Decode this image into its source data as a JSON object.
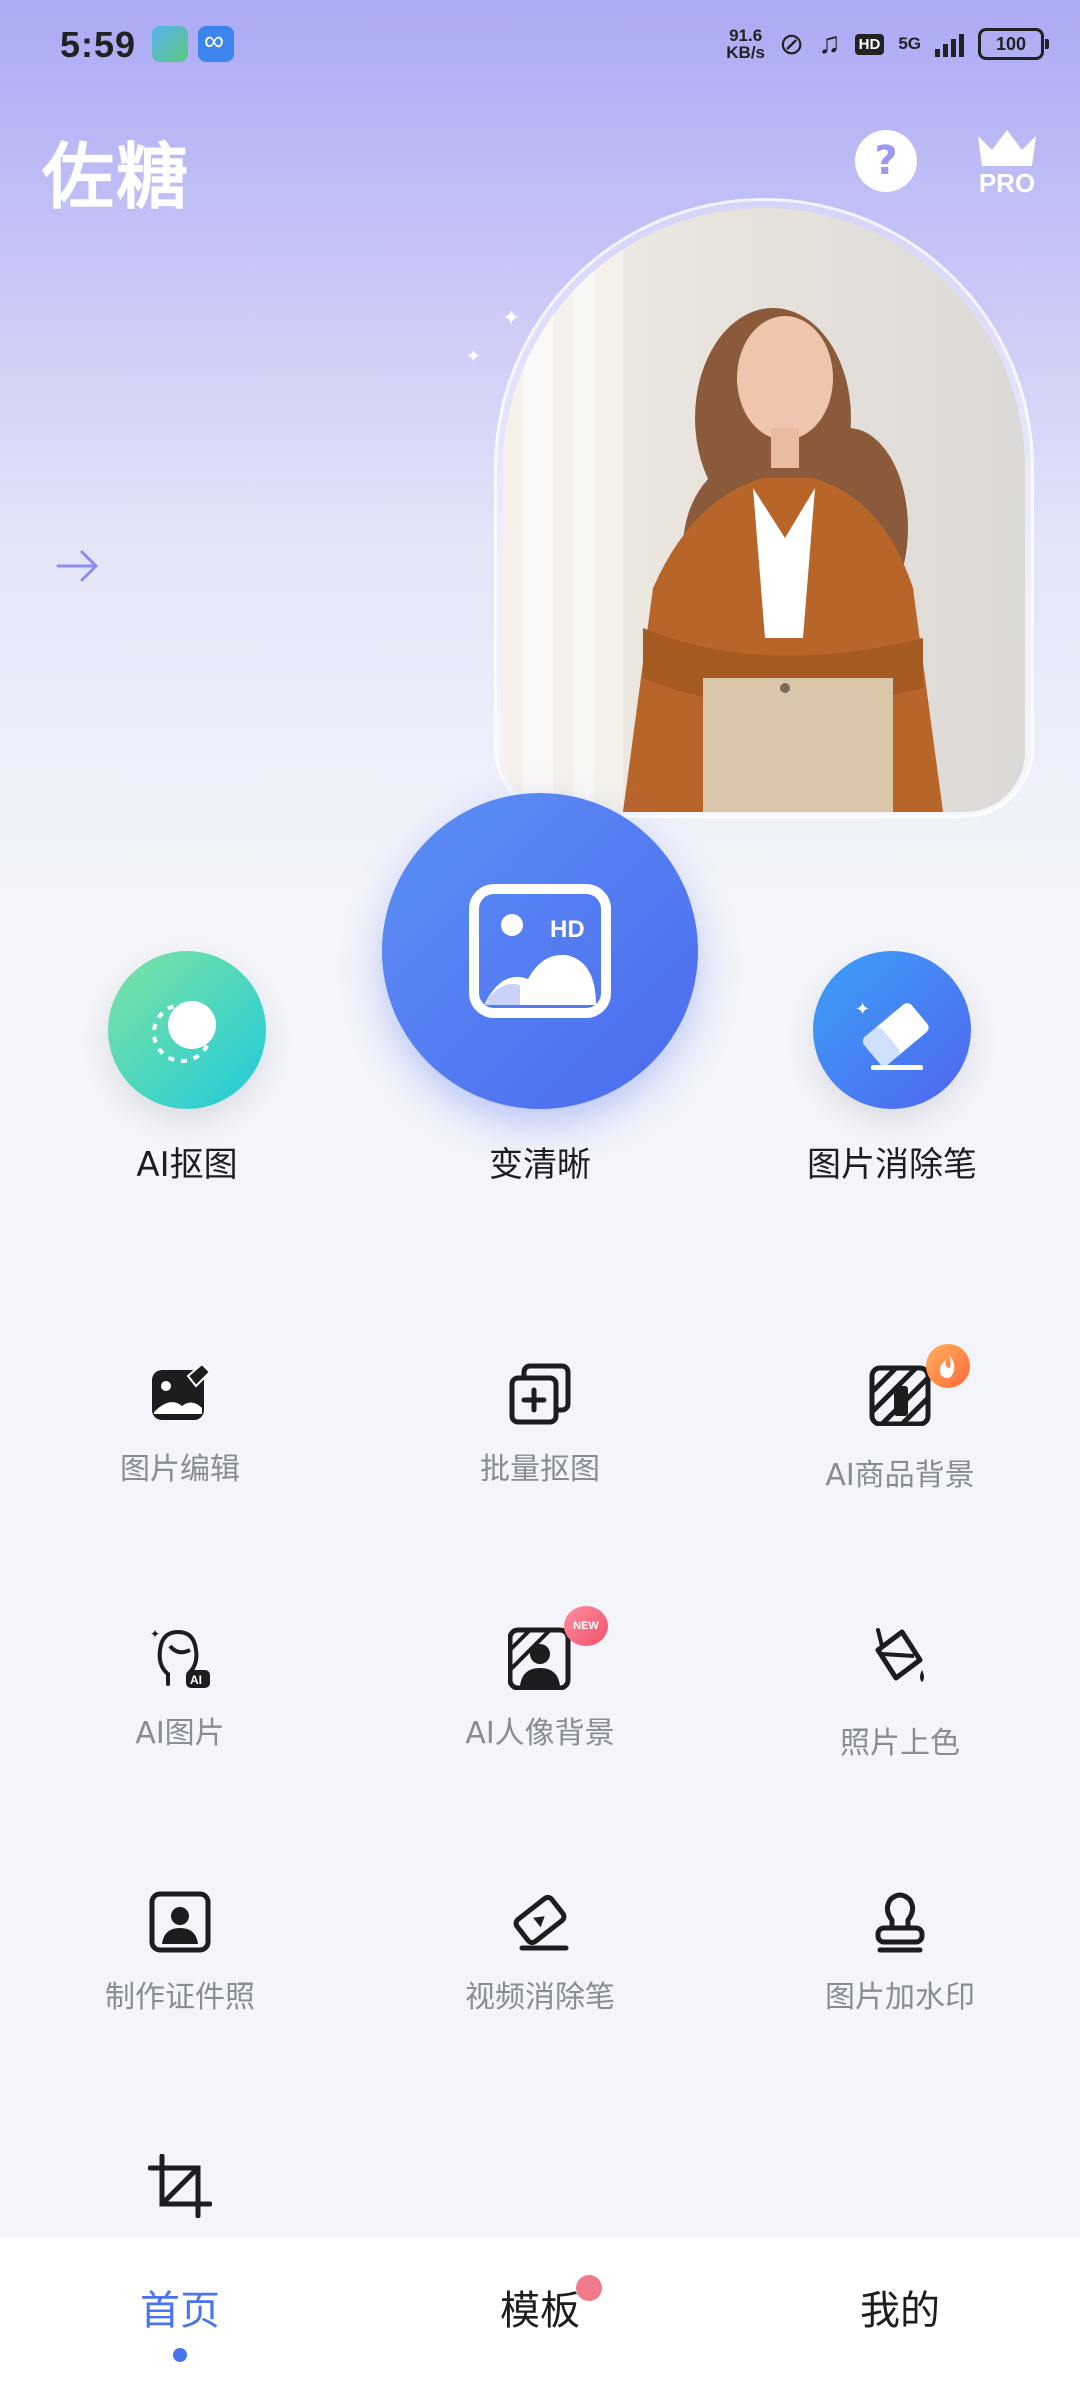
{
  "status_bar": {
    "time": "5:59",
    "net_speed_value": "91.6",
    "net_speed_unit": "KB/s",
    "hd": "HD",
    "network": "5G",
    "battery": "100"
  },
  "header": {
    "app_title": "佐糖",
    "help_label": "?",
    "pro_label": "PRO"
  },
  "main_features": [
    {
      "label": "AI抠图"
    },
    {
      "label": "变清晰",
      "icon_text": "HD"
    },
    {
      "label": "图片消除笔"
    }
  ],
  "tools": [
    {
      "label": "图片编辑",
      "icon": "image-edit-icon"
    },
    {
      "label": "批量抠图",
      "icon": "batch-cutout-icon"
    },
    {
      "label": "AI商品背景",
      "icon": "product-background-icon",
      "badge": "hot"
    },
    {
      "label": "AI图片",
      "icon": "ai-image-icon",
      "icon_text": "AI"
    },
    {
      "label": "AI人像背景",
      "icon": "portrait-background-icon",
      "badge": "NEW"
    },
    {
      "label": "照片上色",
      "icon": "paint-bucket-icon"
    },
    {
      "label": "制作证件照",
      "icon": "id-photo-icon"
    },
    {
      "label": "视频消除笔",
      "icon": "video-eraser-icon"
    },
    {
      "label": "图片加水印",
      "icon": "watermark-stamp-icon"
    },
    {
      "label": "",
      "icon": "crop-icon"
    }
  ],
  "bottom_nav": [
    {
      "label": "首页",
      "active": true
    },
    {
      "label": "模板",
      "has_dot": true
    },
    {
      "label": "我的"
    }
  ],
  "colors": {
    "accent": "#4a74ee",
    "header_gradient_top": "#abaaf3"
  }
}
